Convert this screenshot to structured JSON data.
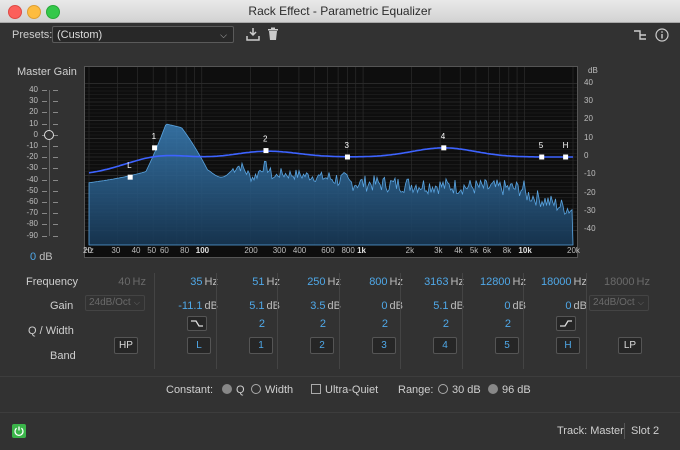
{
  "window": {
    "title": "Rack Effect - Parametric Equalizer"
  },
  "presets": {
    "label": "Presets:",
    "value": "(Custom)"
  },
  "master_gain": {
    "label": "Master Gain",
    "value": "0",
    "unit": "dB",
    "ticks": [
      "40",
      "30",
      "20",
      "10",
      "0",
      "-10",
      "-20",
      "-30",
      "-40",
      "-50",
      "-60",
      "-70",
      "-80",
      "-90"
    ]
  },
  "graph": {
    "db_unit": "dB",
    "db_ticks": [
      "40",
      "30",
      "20",
      "10",
      "0",
      "-10",
      "-20",
      "-30",
      "-40"
    ],
    "hz_unit": "Hz",
    "freq_ticks": [
      "20",
      "30",
      "40",
      "50",
      "60",
      "80",
      "100",
      "200",
      "300",
      "400",
      "600",
      "800",
      "1k",
      "2k",
      "3k",
      "4k",
      "5k",
      "6k",
      "8k",
      "10k",
      "20k"
    ],
    "band_markers": [
      "L",
      "1",
      "2",
      "3",
      "4",
      "5",
      "H"
    ]
  },
  "rows": {
    "frequency": "Frequency",
    "gain": "Gain",
    "q_width": "Q / Width",
    "band": "Band"
  },
  "bands": [
    {
      "id": "hp",
      "freq": "40",
      "gain": "24dB/Oct",
      "q": "",
      "band": "HP",
      "disabled": true
    },
    {
      "id": "l",
      "freq": "35",
      "gain": "-11.1",
      "q": "",
      "band": "L",
      "disabled": false
    },
    {
      "id": "1",
      "freq": "51",
      "gain": "5.1",
      "q": "2",
      "band": "1",
      "disabled": false
    },
    {
      "id": "2",
      "freq": "250",
      "gain": "3.5",
      "q": "2",
      "band": "2",
      "disabled": false
    },
    {
      "id": "3",
      "freq": "800",
      "gain": "0",
      "q": "2",
      "band": "3",
      "disabled": false
    },
    {
      "id": "4",
      "freq": "3163",
      "gain": "5.1",
      "q": "2",
      "band": "4",
      "disabled": false
    },
    {
      "id": "5",
      "freq": "12800",
      "gain": "0",
      "q": "2",
      "band": "5",
      "disabled": false
    },
    {
      "id": "h",
      "freq": "18000",
      "gain": "0",
      "q": "",
      "band": "H",
      "disabled": false
    },
    {
      "id": "lp",
      "freq": "18000",
      "gain": "24dB/Oct",
      "q": "",
      "band": "LP",
      "disabled": true
    }
  ],
  "units": {
    "hz": "Hz",
    "db": "dB"
  },
  "constant": {
    "label": "Constant:",
    "q": "Q",
    "width": "Width"
  },
  "ultra_quiet": "Ultra-Quiet",
  "range": {
    "label": "Range:",
    "opt1": "30 dB",
    "opt2": "96 dB"
  },
  "footer": {
    "track": "Track: Master",
    "slot": "Slot 2"
  },
  "colors": {
    "accent": "#4fa8e8",
    "power": "#3bb54a"
  }
}
